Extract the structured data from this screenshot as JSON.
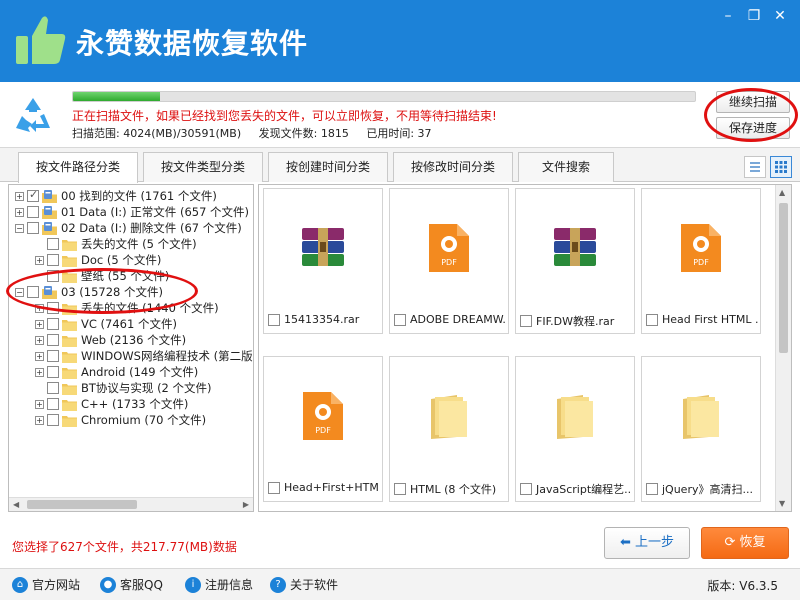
{
  "app": {
    "title": "永赞数据恢复软件"
  },
  "window": {
    "minimize": "–",
    "maximize": "❐",
    "close": "✕"
  },
  "scan": {
    "progress": 0.14,
    "message": "正在扫描文件，如果已经找到您丢失的文件，可以立即恢复，不用等待扫描结束!",
    "range": "扫描范围: 4024(MB)/30591(MB)",
    "found": "发现文件数: 1815",
    "elapsed": "已用时间: 37",
    "continue_label": "继续扫描",
    "save_label": "保存进度"
  },
  "tabs": [
    "按文件路径分类",
    "按文件类型分类",
    "按创建时间分类",
    "按修改时间分类",
    "文件搜索"
  ],
  "tree": [
    {
      "label": "00 找到的文件  (1761 个文件)",
      "level": 0,
      "toggle": "+",
      "checked": true,
      "icon": "drive"
    },
    {
      "label": "01 Data (I:) 正常文件  (657 个文件)",
      "level": 0,
      "toggle": "+",
      "checked": false,
      "icon": "drive"
    },
    {
      "label": "02 Data (I:) 删除文件  (67 个文件)",
      "level": 0,
      "toggle": "−",
      "checked": false,
      "icon": "drive"
    },
    {
      "label": "丢失的文件    (5 个文件)",
      "level": 1,
      "toggle": "",
      "checked": false,
      "icon": "folder"
    },
    {
      "label": "Doc    (5 个文件)",
      "level": 1,
      "toggle": "+",
      "checked": false,
      "icon": "folder"
    },
    {
      "label": "壁纸    (55 个文件)",
      "level": 1,
      "toggle": "",
      "checked": false,
      "icon": "folder"
    },
    {
      "label": "03  (15728 个文件)",
      "level": 0,
      "toggle": "−",
      "checked": false,
      "icon": "drive"
    },
    {
      "label": "丢失的文件    (1440 个文件)",
      "level": 1,
      "toggle": "+",
      "checked": false,
      "icon": "folder"
    },
    {
      "label": "VC    (7461 个文件)",
      "level": 1,
      "toggle": "+",
      "checked": false,
      "icon": "folder"
    },
    {
      "label": "Web    (2136 个文件)",
      "level": 1,
      "toggle": "+",
      "checked": false,
      "icon": "folder"
    },
    {
      "label": "WINDOWS网络编程技术 (第二版)",
      "level": 1,
      "toggle": "+",
      "checked": false,
      "icon": "folder"
    },
    {
      "label": "Android    (149 个文件)",
      "level": 1,
      "toggle": "+",
      "checked": false,
      "icon": "folder"
    },
    {
      "label": "BT协议与实现    (2 个文件)",
      "level": 1,
      "toggle": "",
      "checked": false,
      "icon": "folder"
    },
    {
      "label": "C++    (1733 个文件)",
      "level": 1,
      "toggle": "+",
      "checked": false,
      "icon": "folder"
    },
    {
      "label": "Chromium    (70 个文件)",
      "level": 1,
      "toggle": "+",
      "checked": false,
      "icon": "folder"
    }
  ],
  "files": [
    {
      "name": "15413354.rar",
      "type": "rar"
    },
    {
      "name": "ADOBE DREAMW...",
      "type": "pdf"
    },
    {
      "name": "FIF.DW教程.rar",
      "type": "rar"
    },
    {
      "name": "Head First HTML ...",
      "type": "pdf"
    },
    {
      "name": "Head+First+HTM...",
      "type": "pdf"
    },
    {
      "name": "HTML (8 个文件)",
      "type": "folder"
    },
    {
      "name": "JavaScript编程艺...",
      "type": "folder"
    },
    {
      "name": "jQuery》高清扫...",
      "type": "folder"
    }
  ],
  "pdf_label": "PDF",
  "footer": {
    "selection": "您选择了627个文件，共217.77(MB)数据",
    "prev_label": "上一步",
    "recover_label": "恢复",
    "links": [
      "官方网站",
      "客服QQ",
      "注册信息",
      "关于软件"
    ],
    "version": "版本: V6.3.5"
  },
  "colors": {
    "brand": "#1c82d8",
    "accent": "#f46a14",
    "alert": "#d11111"
  }
}
